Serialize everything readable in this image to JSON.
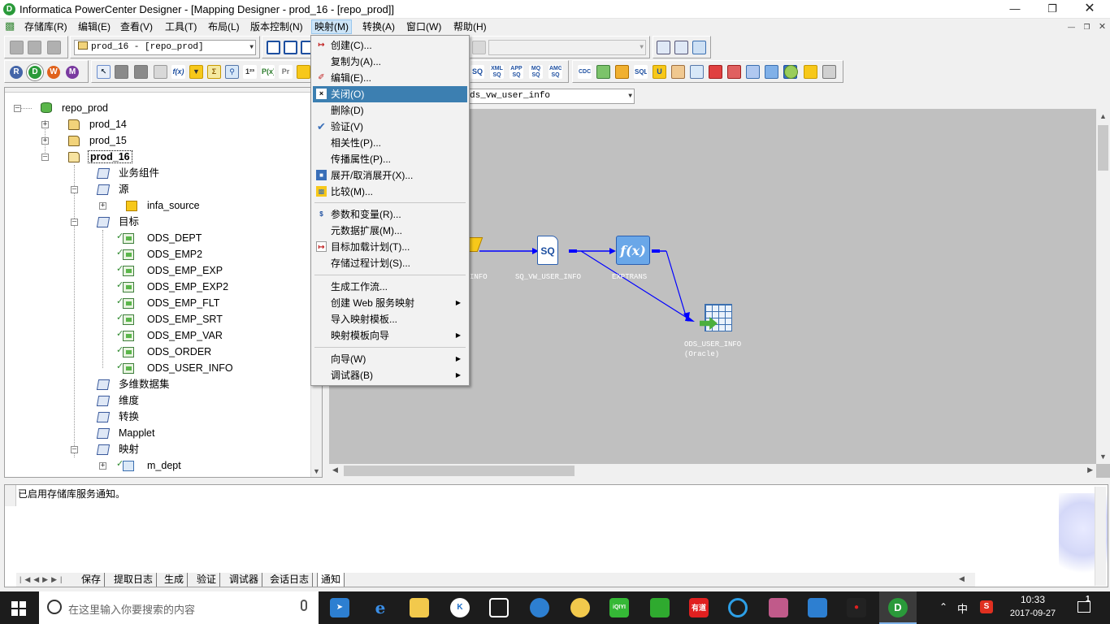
{
  "window": {
    "title": "Informatica PowerCenter Designer - [Mapping Designer - prod_16 - [repo_prod]]",
    "app_icon": "D"
  },
  "menubar": {
    "items": [
      "存储库(R)",
      "编辑(E)",
      "查看(V)",
      "工具(T)",
      "布局(L)",
      "版本控制(N)",
      "映射(M)",
      "转换(A)",
      "窗口(W)",
      "帮助(H)"
    ]
  },
  "toolbar": {
    "folder_combo": "prod_16 - [repo_prod]",
    "mapping_combo": "ds_vw_user_info",
    "tool_circles": [
      "R",
      "D",
      "W",
      "M"
    ],
    "transform_labels": [
      "SQ",
      "XML SQ",
      "APP SQ",
      "MQ SQ",
      "AMG SQ",
      "CDC",
      "SQL",
      "U"
    ]
  },
  "navigator": {
    "items": [
      {
        "label": "repo_prod",
        "type": "repo"
      },
      {
        "label": "prod_14",
        "type": "folder"
      },
      {
        "label": "prod_15",
        "type": "folder"
      },
      {
        "label": "prod_16",
        "type": "folder",
        "selected": true
      },
      {
        "label": "业务组件",
        "type": "node"
      },
      {
        "label": "源",
        "type": "node"
      },
      {
        "label": "infa_source",
        "type": "source"
      },
      {
        "label": "目标",
        "type": "node"
      },
      {
        "label": "ODS_DEPT",
        "type": "target"
      },
      {
        "label": "ODS_EMP2",
        "type": "target"
      },
      {
        "label": "ODS_EMP_EXP",
        "type": "target"
      },
      {
        "label": "ODS_EMP_EXP2",
        "type": "target"
      },
      {
        "label": "ODS_EMP_FLT",
        "type": "target"
      },
      {
        "label": "ODS_EMP_SRT",
        "type": "target"
      },
      {
        "label": "ODS_EMP_VAR",
        "type": "target"
      },
      {
        "label": "ODS_ORDER",
        "type": "target"
      },
      {
        "label": "ODS_USER_INFO",
        "type": "target"
      },
      {
        "label": "多维数据集",
        "type": "node"
      },
      {
        "label": "维度",
        "type": "node"
      },
      {
        "label": "转换",
        "type": "node"
      },
      {
        "label": "Mapplet",
        "type": "node"
      },
      {
        "label": "映射",
        "type": "node"
      },
      {
        "label": "m_dept",
        "type": "mapping"
      }
    ]
  },
  "workspace": {
    "nodes": [
      {
        "name": "source",
        "label": "INFO"
      },
      {
        "name": "sq",
        "label": "SQ_VW_USER_INFO",
        "icon_text": "SQ"
      },
      {
        "name": "expression",
        "label": "EXPTRANS",
        "icon_text": "f(x)"
      },
      {
        "name": "target",
        "label": "ODS_USER_INFO",
        "sublabel": "(Oracle)"
      }
    ]
  },
  "mapping_menu": {
    "items": [
      {
        "label": "创建(C)...",
        "icon": "create-icon"
      },
      {
        "label": "复制为(A)..."
      },
      {
        "label": "编辑(E)...",
        "icon": "edit-icon"
      },
      {
        "label": "关闭(O)",
        "icon": "close-mapping-icon",
        "highlighted": true
      },
      {
        "label": "删除(D)"
      },
      {
        "label": "验证(V)",
        "icon": "checkmark-icon"
      },
      {
        "label": "相关性(P)..."
      },
      {
        "label": "传播属性(P)..."
      },
      {
        "label": "展开/取消展开(X)...",
        "icon": "expand-icon"
      },
      {
        "label": "比较(M)...",
        "icon": "compare-icon"
      },
      {
        "separator": true
      },
      {
        "label": "参数和变量(R)...",
        "icon": "parameter-icon"
      },
      {
        "label": "元数据扩展(M)..."
      },
      {
        "label": "目标加载计划(T)...",
        "icon": "target-load-icon"
      },
      {
        "label": "存储过程计划(S)..."
      },
      {
        "separator": true
      },
      {
        "label": "生成工作流..."
      },
      {
        "label": "创建 Web 服务映射",
        "submenu": true
      },
      {
        "label": "导入映射模板..."
      },
      {
        "label": "映射模板向导",
        "submenu": true
      },
      {
        "separator": true
      },
      {
        "label": "向导(W)",
        "submenu": true
      },
      {
        "label": "调试器(B)",
        "submenu": true
      }
    ]
  },
  "output": {
    "message": "已启用存储库服务通知。",
    "tabs": [
      "保存",
      "提取日志",
      "生成",
      "验证",
      "调试器",
      "会话日志",
      "通知"
    ],
    "active_tab": "通知"
  },
  "taskbar": {
    "search_placeholder": "在这里输入你要搜索的内容",
    "app_labels": [
      "K",
      "iQIYI",
      "有道",
      "D"
    ],
    "ime": "中",
    "time": "10:33",
    "date": "2017-09-27",
    "notification_count": "1"
  },
  "colors": {
    "highlight": "#3c7fb1",
    "workspace": "#c0c0c0",
    "link": "#0000ff"
  }
}
